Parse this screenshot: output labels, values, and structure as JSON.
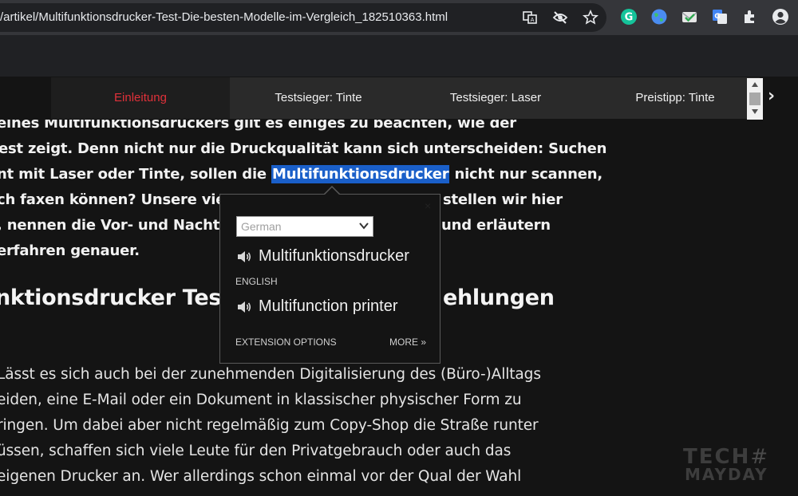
{
  "browser": {
    "url": "/artikel/Multifunktionsdrucker-Test-Die-besten-Modelle-im-Vergleich_182510363.html",
    "icons": [
      "translate-icon",
      "eye-off-icon",
      "star-icon",
      "grammarly-icon",
      "globe-icon",
      "email-check-icon",
      "google-translate-icon",
      "puzzle-icon",
      "account-icon"
    ]
  },
  "section_nav": {
    "tabs": [
      {
        "label": "Einleitung",
        "active": true
      },
      {
        "label": "Testsieger: Tinte",
        "active": false
      },
      {
        "label": "Testsieger: Laser",
        "active": false
      },
      {
        "label": "Preistipp: Tinte",
        "active": false
      }
    ],
    "next": "›"
  },
  "article": {
    "intro_lines": [
      "eines Multifunktionsdruckers gilt es einiges zu beachten, wie der",
      "est zeigt. Denn nicht nur die Druckqualität kann sich unterscheiden: Suchen",
      {
        "before": "nt mit Laser oder Tinte, sollen die ",
        "highlight": "Multifunktionsdrucker",
        "after": " nicht nur scannen,"
      },
      {
        "left": "ch faxen können? Unsere vier",
        "right": "stellen wir hier"
      },
      {
        "left": ", nennen die Vor- und Nachte",
        "right": "und erläutern"
      },
      "erfahren genauer."
    ],
    "heading": {
      "left": "nktionsdrucker Test",
      "right": "ehlungen"
    },
    "body_lines": [
      "Lässt es sich auch bei der zunehmenden Digitalisierung des (Büro-)Alltags",
      "eiden, eine E-Mail oder ein Dokument in klassischer physischer Form zu",
      "ringen. Um dabei aber nicht regelmäßig zum Copy-Shop die Straße runter",
      "üssen, schaffen sich viele Leute für den Privatgebrauch oder auch das",
      "eigenen Drucker an. Wer allerdings schon einmal vor der Qual der Wahl"
    ]
  },
  "translate_popup": {
    "source_language": "German",
    "source_word": "Multifunktionsdrucker",
    "target_language_label": "ENGLISH",
    "translated_word": "Multifunction printer",
    "options_label": "EXTENSION OPTIONS",
    "more_label": "MORE »",
    "close_label": "×"
  },
  "watermark": {
    "line1": "TECH",
    "line2": "MAYDAY",
    "hash": "#"
  }
}
